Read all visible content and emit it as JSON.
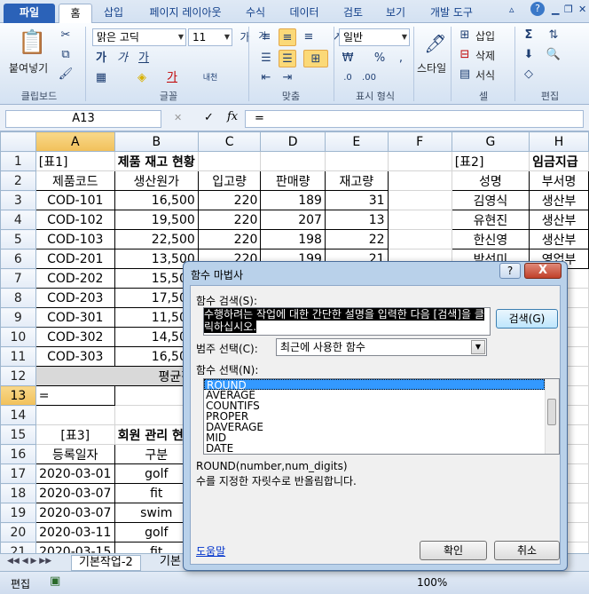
{
  "ribbon": {
    "tabs": [
      "파일",
      "홈",
      "삽입",
      "페이지 레이아웃",
      "수식",
      "데이터",
      "검토",
      "보기",
      "개발 도구"
    ],
    "clipboard": {
      "paste": "붙여넣기",
      "label": "클립보드"
    },
    "font": {
      "name": "맑은 고딕",
      "size": "11",
      "label": "글꼴",
      "bold": "가",
      "italic": "가",
      "underline": "가",
      "grow": "가",
      "shrink": "가",
      "color": "가",
      "phonetic": "내천"
    },
    "align": {
      "label": "맞춤"
    },
    "number": {
      "format": "일반",
      "label": "표시 형식",
      "percent": "%"
    },
    "styles": {
      "label": "스타일"
    },
    "cells": {
      "insert": "삽입",
      "delete": "삭제",
      "format": "서식",
      "label": "셀"
    },
    "edit": {
      "label": "편집"
    }
  },
  "formula": {
    "namebox": "A13",
    "content": "="
  },
  "sheet": {
    "cols": [
      "A",
      "B",
      "C",
      "D",
      "E",
      "F",
      "G",
      "H"
    ],
    "rows": [
      {
        "n": "1",
        "A": "[표1]",
        "B": "제품 재고 현황",
        "G": "[표2]",
        "H": "임금지급"
      },
      {
        "n": "2",
        "A": "제품코드",
        "B": "생산원가",
        "C": "입고량",
        "D": "판매량",
        "E": "재고량",
        "G": "성명",
        "H": "부서명"
      },
      {
        "n": "3",
        "A": "COD-101",
        "B": "16,500",
        "C": "220",
        "D": "189",
        "E": "31",
        "G": "김영식",
        "H": "생산부"
      },
      {
        "n": "4",
        "A": "COD-102",
        "B": "19,500",
        "C": "220",
        "D": "207",
        "E": "13",
        "G": "유현진",
        "H": "생산부"
      },
      {
        "n": "5",
        "A": "COD-103",
        "B": "22,500",
        "C": "220",
        "D": "198",
        "E": "22",
        "G": "한신영",
        "H": "생산부"
      },
      {
        "n": "6",
        "A": "COD-201",
        "B": "13,500",
        "C": "220",
        "D": "199",
        "E": "21",
        "G": "박선미",
        "H": "영업부"
      },
      {
        "n": "7",
        "A": "COD-202",
        "B": "15,500"
      },
      {
        "n": "8",
        "A": "COD-203",
        "B": "17,500"
      },
      {
        "n": "9",
        "A": "COD-301",
        "B": "11,500"
      },
      {
        "n": "10",
        "A": "COD-302",
        "B": "14,500"
      },
      {
        "n": "11",
        "A": "COD-303",
        "B": "16,500"
      },
      {
        "n": "12",
        "A": "평균판매량 이상이면"
      },
      {
        "n": "13",
        "A": "="
      },
      {
        "n": "14"
      },
      {
        "n": "15",
        "A": "[표3]",
        "B": "회원 관리 현"
      },
      {
        "n": "16",
        "A": "등록일자",
        "B": "구분"
      },
      {
        "n": "17",
        "A": "2020-03-01",
        "B": "golf"
      },
      {
        "n": "18",
        "A": "2020-03-07",
        "B": "fit"
      },
      {
        "n": "19",
        "A": "2020-03-07",
        "B": "swim"
      },
      {
        "n": "20",
        "A": "2020-03-11",
        "B": "golf"
      },
      {
        "n": "21",
        "A": "2020-03-15",
        "B": "fit"
      }
    ],
    "tabs": [
      "기본작업-2",
      "기본"
    ],
    "status": "편집",
    "zoom": "100%"
  },
  "dialog": {
    "title": "함수 마법사",
    "help_btn": "?",
    "close_btn": "X",
    "search_label": "함수 검색(S):",
    "search_text": "수행하려는 작업에 대한 간단한 설명을 입력한 다음 [검색]을 클릭하십시오.",
    "search_btn": "검색(G)",
    "category_label": "범주 선택(C):",
    "category_value": "최근에 사용한 함수",
    "func_label": "함수 선택(N):",
    "functions": [
      "ROUND",
      "AVERAGE",
      "COUNTIFS",
      "PROPER",
      "DAVERAGE",
      "MID",
      "DATE"
    ],
    "signature": "ROUND(number,num_digits)",
    "description": "수를 지정한 자릿수로 반올림합니다.",
    "help_link": "도움말",
    "ok": "확인",
    "cancel": "취소"
  }
}
